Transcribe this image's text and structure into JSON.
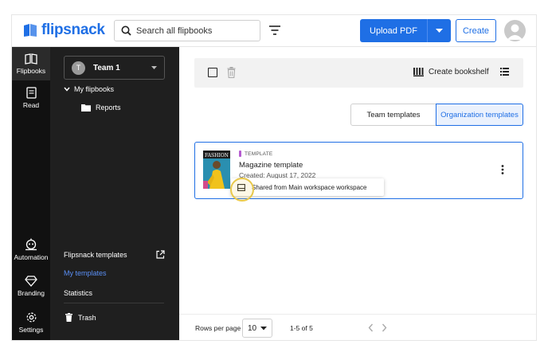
{
  "app": {
    "logo_text": "flipsnack",
    "brand_color": "#1f6fe5"
  },
  "topbar": {
    "search_placeholder": "Search all flipbooks",
    "upload_label": "Upload PDF",
    "create_label": "Create"
  },
  "rail": {
    "items": [
      {
        "label": "Flipbooks",
        "icon": "flipbooks-icon"
      },
      {
        "label": "Read",
        "icon": "read-icon"
      },
      {
        "label": "Automation",
        "icon": "automation-icon"
      },
      {
        "label": "Branding",
        "icon": "branding-icon"
      },
      {
        "label": "Settings",
        "icon": "settings-icon"
      }
    ]
  },
  "sidebar": {
    "team_initial": "T",
    "team_name": "Team 1",
    "my_flipbooks": "My flipbooks",
    "reports": "Reports",
    "flipsnack_templates": "Flipsnack templates",
    "my_templates": "My templates",
    "statistics": "Statistics",
    "trash": "Trash"
  },
  "toolbar": {
    "create_bookshelf": "Create bookshelf"
  },
  "tabs": {
    "team_templates": "Team templates",
    "organization_templates": "Organization templates"
  },
  "card": {
    "tag": "TEMPLATE",
    "title": "Magazine template",
    "date": "Created: August 17, 2022",
    "tooltip": "Shared from Main workspace workspace",
    "thumb_text": "FASHION"
  },
  "footer": {
    "rows_per_page_label": "Rows per page",
    "rows_per_page_value": "10",
    "range": "1-5 of 5"
  }
}
